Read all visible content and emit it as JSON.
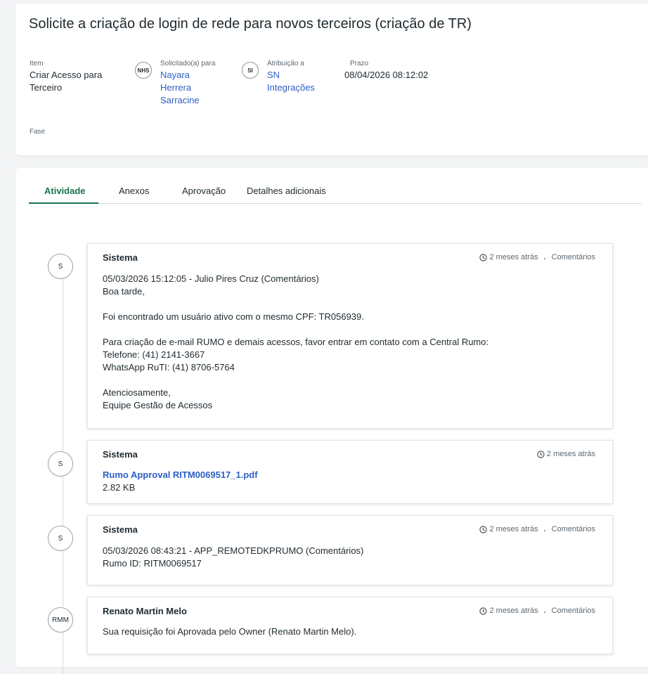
{
  "header": {
    "title": "Solicite a criação de login de rede para novos terceiros (criação de TR)",
    "item": {
      "label": "Item",
      "value_line1": "Criar Acesso para",
      "value_line2": "Terceiro"
    },
    "requested_for": {
      "label": "Solicitado(a) para",
      "avatar": "NHS",
      "line1": "Nayara",
      "line2": "Herrera",
      "line3": "Sarracine"
    },
    "assigned_to": {
      "label": "Atribuição a",
      "avatar": "SI",
      "line1": "SN",
      "line2": "Integrações"
    },
    "due": {
      "label": "Prazo",
      "value": "08/04/2026 08:12:02"
    },
    "phase": {
      "label": "Fase"
    }
  },
  "tabs": [
    "Atividade",
    "Anexos",
    "Aprovação",
    "Detalhes adicionais"
  ],
  "entries": [
    {
      "avatar": "S",
      "author": "Sistema",
      "time": "2 meses atrás",
      "type": "Comentários",
      "lines": [
        "05/03/2026 15:12:05 - Julio Pires Cruz (Comentários)",
        "Boa tarde,",
        "",
        "Foi encontrado um usuário ativo com o mesmo CPF: TR056939.",
        "",
        "Para criação de e-mail RUMO e demais acessos, favor entrar em contato com a Central Rumo:",
        "Telefone: (41) 2141-3667",
        "WhatsApp RuTI: (41) 8706-5764",
        "",
        "Atenciosamente,",
        "Equipe Gestão de Acessos"
      ]
    },
    {
      "avatar": "S",
      "author": "Sistema",
      "time": "2 meses atrás",
      "attachment": "Rumo Approval RITM0069517_1.pdf",
      "size": "2.82 KB"
    },
    {
      "avatar": "S",
      "author": "Sistema",
      "time": "2 meses atrás",
      "type": "Comentários",
      "lines": [
        "05/03/2026 08:43:21 - APP_REMOTEDKPRUMO (Comentários)",
        "Rumo ID: RITM0069517"
      ]
    },
    {
      "avatar": "RMM",
      "author": "Renato Martin Melo",
      "time": "2 meses atrás",
      "type": "Comentários",
      "lines": [
        "Sua requisição foi Aprovada pelo Owner (Renato Martin Melo)."
      ]
    }
  ]
}
